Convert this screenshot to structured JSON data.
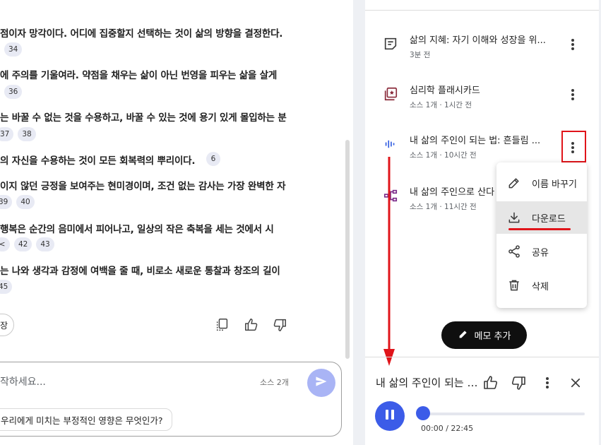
{
  "chat": {
    "answers": [
      {
        "text": "점이자 망각이다. 어디에 집중할지 선택하는 것이 삶의 방향을 결정한다.",
        "citations": [
          "34"
        ]
      },
      {
        "text": "에 주의를 기울여라. 약점을 채우는 삶이 아닌 번영을 피우는 삶을 살게",
        "citations": [
          "36"
        ]
      },
      {
        "text": "는 바꿀 수 없는 것을 수용하고, 바꿀 수 있는 것에 용기 있게 몰입하는 분",
        "citations": [
          "37",
          "38"
        ]
      },
      {
        "text": "의 자신을 수용하는 것이 모든 회복력의 뿌리이다.",
        "citations": [
          "6"
        ]
      },
      {
        "text": "이지 않던 긍정을 보여주는 현미경이며, 조건 없는 감사는 가장 완벽한 자",
        "citations": [
          "39",
          "40"
        ]
      },
      {
        "text": "행복은 순간의 음미에서 피어나고, 일상의 작은 축복을 세는 것에서 시",
        "citations": [
          "<",
          "42",
          "43"
        ]
      },
      {
        "text": "는 나와 생각과 감정에 여백을 줄 때, 비로소 새로운 통찰과 창조의 길이",
        "citations": [
          "45"
        ]
      }
    ],
    "save_label": "장",
    "input_placeholder": "작하세요...",
    "source_count": "소스 2개",
    "suggestion": "우리에게 미치는 부정적인 영향은 무엇인가?"
  },
  "studio": {
    "notes": [
      {
        "title": "삶의 지혜: 자기 이해와 성장을 위...",
        "meta": "3분 전",
        "icon": "note-icon"
      },
      {
        "title": "심리학 플래시카드",
        "meta": "소스 1개 · 1시간 전",
        "icon": "flashcard-icon"
      },
      {
        "title": "내 삶의 주인이 되는 법: 흔들림 ...",
        "meta": "소스 1개 · 10시간 전",
        "icon": "audio-icon"
      },
      {
        "title": "내 삶의 주인으로 산다",
        "meta": "소스 1개 · 11시간 전",
        "icon": "mindmap-icon"
      }
    ],
    "context_menu": [
      {
        "label": "이름 바꾸기",
        "icon": "pencil-icon"
      },
      {
        "label": "다운로드",
        "icon": "download-icon"
      },
      {
        "label": "공유",
        "icon": "share-icon"
      },
      {
        "label": "삭제",
        "icon": "trash-icon"
      }
    ],
    "add_note_label": "메모 추가",
    "accent_color": "#3c5ce8",
    "highlight_color": "#e0141a"
  },
  "player": {
    "title": "내 삶의 주인이 되는 법: 흔들림",
    "time": "00:00 / 22:45",
    "progress_percent": 0
  }
}
